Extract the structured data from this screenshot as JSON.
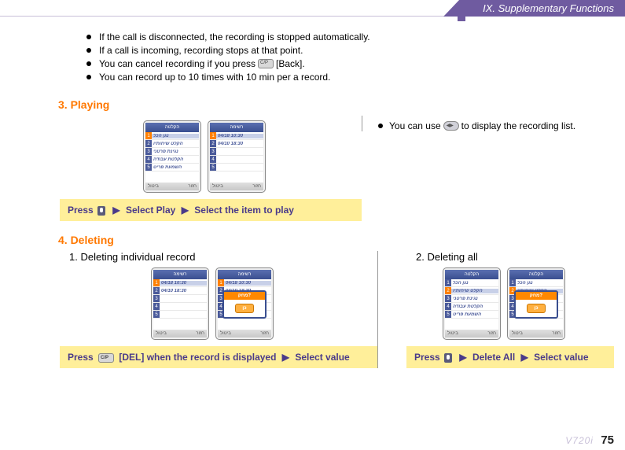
{
  "header": {
    "chapter": "IX. Supplementary Functions"
  },
  "bullets": [
    {
      "text": "If the call is disconnected, the recording is stopped automatically."
    },
    {
      "text": "If a call is incoming, recording stops at that point."
    },
    {
      "pre": "You can cancel recording if you press",
      "post": "[Back].",
      "icon": true
    },
    {
      "text": "You can record up to 10 times with 10 min per a record."
    }
  ],
  "section3": {
    "title": "3. Playing",
    "instruction": {
      "press": "Press",
      "step1": "Select Play",
      "step2": "Select the item to play",
      "arrow": "▶"
    },
    "note": {
      "pre": "You can use",
      "post": "to display the recording list."
    },
    "screens": {
      "menu_title": "הקלטה",
      "list_title": "רשימה",
      "menu_items": [
        "נגן הכל",
        "הקלט שיחותיו",
        "נגינת פרטני",
        "הקלטת עבודה",
        "השמעת פריט"
      ],
      "list_items": [
        "04/18 10:30",
        "04/10 18:30",
        "",
        "",
        ""
      ],
      "soft_left": "ביטול",
      "soft_right": "חזור"
    }
  },
  "section4": {
    "title": "4. Deleting",
    "sub1": {
      "title": "1. Deleting individual record",
      "instruction": {
        "press": "Press",
        "mid": "[DEL] when the record is displayed",
        "step2": "Select value",
        "arrow": "▶"
      },
      "popup_title": "מחק?",
      "popup_btn": "כן"
    },
    "sub2": {
      "title": "2. Deleting all",
      "instruction": {
        "press": "Press",
        "step1": "Delete All",
        "step2": "Select value",
        "arrow": "▶"
      },
      "popup_title": "מחק?",
      "popup_btn": "כן"
    }
  },
  "footer": {
    "model": "V720i",
    "page": "75"
  }
}
